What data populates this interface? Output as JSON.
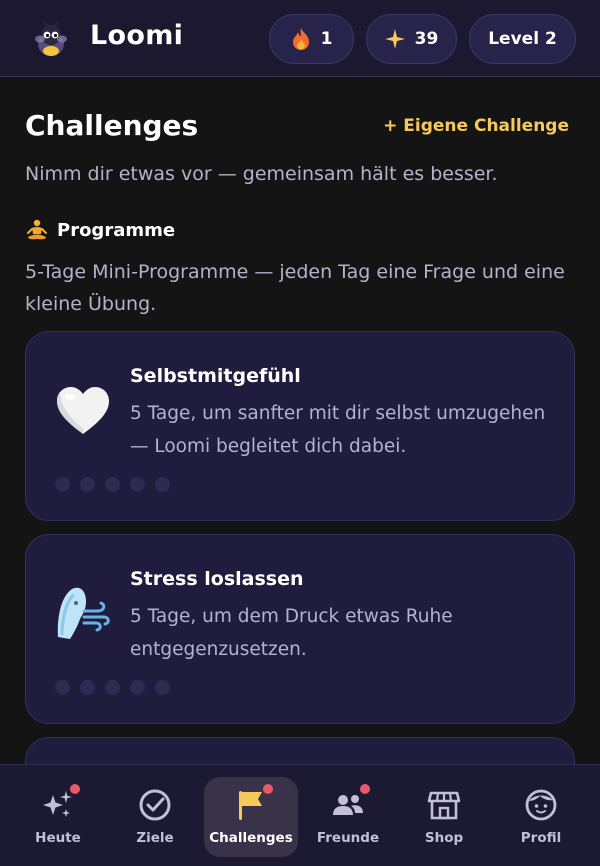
{
  "header": {
    "app_title": "Loomi",
    "streak": {
      "icon": "fire-icon",
      "value": "1"
    },
    "stars": {
      "icon": "sparkle-icon",
      "value": "39"
    },
    "level": "Level 2"
  },
  "main": {
    "title": "Challenges",
    "own_challenge_link": "+ Eigene Challenge",
    "subtitle": "Nimm dir etwas vor — gemeinsam hält es besser.",
    "section": {
      "icon": "meditation-icon",
      "title": "Programme",
      "description": "5-Tage Mini-Programme — jeden Tag eine Frage und eine kleine Übung."
    },
    "programs": [
      {
        "icon": "white-heart-icon",
        "title": "Selbstmitgefühl",
        "description": "5 Tage, um sanfter mit dir selbst umzugehen — Loomi begleitet dich dabei.",
        "progress_done": 0,
        "progress_total": 5
      },
      {
        "icon": "wind-face-icon",
        "title": "Stress loslassen",
        "description": "5 Tage, um dem Druck etwas Ruhe entgegenzusetzen.",
        "progress_done": 0,
        "progress_total": 5
      }
    ]
  },
  "nav": {
    "items": [
      {
        "label": "Heute",
        "icon": "sparkles-icon",
        "badge": true,
        "active": false
      },
      {
        "label": "Ziele",
        "icon": "check-circle-icon",
        "badge": false,
        "active": false
      },
      {
        "label": "Challenges",
        "icon": "flag-icon",
        "badge": true,
        "active": true
      },
      {
        "label": "Freunde",
        "icon": "users-icon",
        "badge": true,
        "active": false
      },
      {
        "label": "Shop",
        "icon": "store-icon",
        "badge": false,
        "active": false
      },
      {
        "label": "Profil",
        "icon": "profile-icon",
        "badge": false,
        "active": false
      }
    ]
  },
  "colors": {
    "background": "#141414",
    "header": "#1b1830",
    "card": "#201c3e",
    "accent": "#f7c85a",
    "badge": "#e85a6b",
    "text_muted": "#b6b1cc"
  }
}
